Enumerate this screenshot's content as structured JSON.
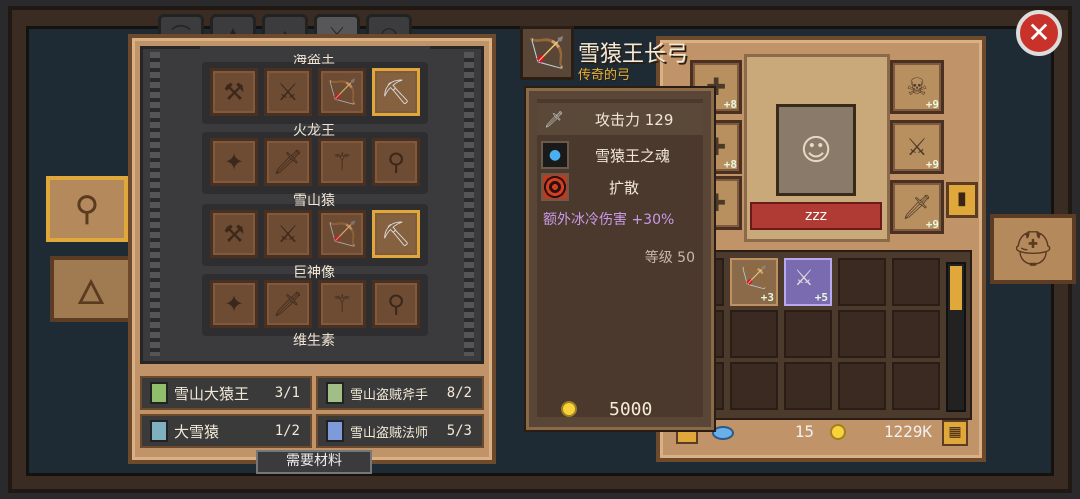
{
  "tabs": [
    {
      "icon": "helmet-icon",
      "active": false
    },
    {
      "icon": "armor-icon",
      "active": false
    },
    {
      "icon": "hat-icon",
      "active": false
    },
    {
      "icon": "weapon-icon",
      "active": true
    },
    {
      "icon": "ring-icon",
      "active": false
    }
  ],
  "groups": [
    {
      "label": "海盗王"
    },
    {
      "label": "火龙王"
    },
    {
      "label": "雪山猿"
    },
    {
      "label": "巨神像"
    },
    {
      "label": "维生素"
    }
  ],
  "materials": [
    {
      "name": "雪山大猿王",
      "count": "3/1",
      "color": "#8fbf6a"
    },
    {
      "name": "雪山盗贼斧手",
      "count": "8/2",
      "color": "#9fbf86"
    },
    {
      "name": "大雪猿",
      "count": "1/2",
      "color": "#7fb0c0"
    },
    {
      "name": "雪山盗贼法师",
      "count": "5/3",
      "color": "#7f9ad8"
    }
  ],
  "need_materials_label": "需要材料",
  "tooltip": {
    "name": "雪猿王长弓",
    "rarity": "传奇的弓",
    "attack_label": "攻击力 129",
    "skill1": "雪猿王之魂",
    "skill2": "扩散",
    "bonus": "额外冰冷伤害 +30%",
    "level": "等级 50",
    "price": "5000"
  },
  "character": {
    "name": "zzz"
  },
  "equip_plus": [
    "+8",
    "+8",
    "+9",
    "+9",
    "+9"
  ],
  "inventory_plus": [
    "+3",
    "+5"
  ],
  "currency": {
    "gems": "15",
    "gold": "1229K"
  },
  "colors": {
    "gold": "#f7d23a",
    "bonus_text": "#c99ae8",
    "close_button": "#c8322a"
  }
}
